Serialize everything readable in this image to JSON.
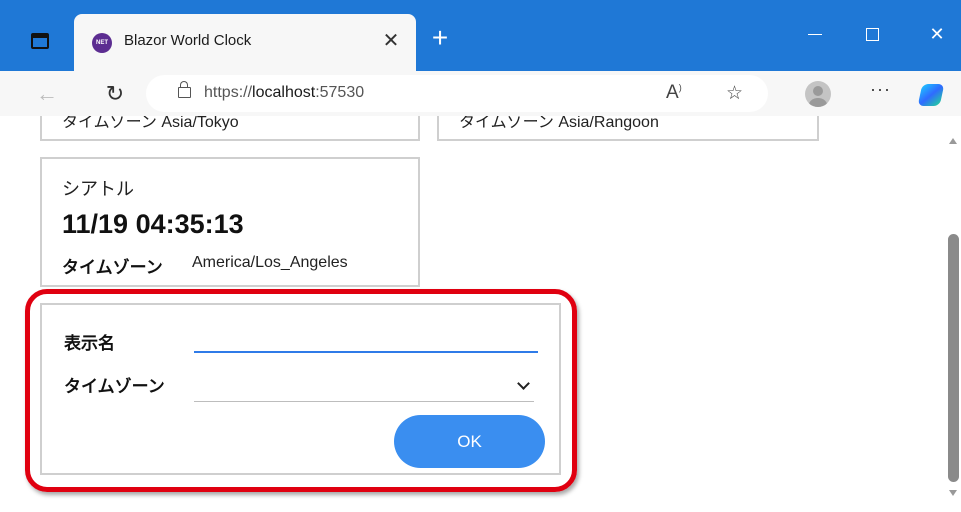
{
  "browser": {
    "tab_title": "Blazor World Clock",
    "favicon_text": "NET",
    "tab_close": "✕",
    "new_tab": "+",
    "url_prefix": "https://",
    "url_host": "localhost",
    "url_port": ":57530",
    "icons": {
      "back": "back-arrow-icon",
      "refresh": "refresh-icon",
      "lock": "site-info-icon",
      "read_aloud": "read-aloud-icon",
      "favorite": "favorite-star-icon",
      "profile": "profile-avatar-icon",
      "more": "more-icon",
      "copilot": "copilot-icon"
    },
    "window_controls": [
      "minimize",
      "maximize",
      "close"
    ]
  },
  "clocks_partial_row": [
    {
      "text": "タイムゾーン  Asia/Tokyo"
    },
    {
      "text": "タイムゾーン  Asia/Rangoon"
    }
  ],
  "clock_card": {
    "name": "シアトル",
    "time": "11/19 04:35:13",
    "tz_label": "タイムゾーン",
    "tz_value": "America/Los_Angeles"
  },
  "add_form": {
    "name_label": "表示名",
    "name_value": "",
    "timezone_label": "タイムゾーン",
    "timezone_value": "",
    "ok_label": "OK"
  },
  "colors": {
    "titlebar": "#1f78d6",
    "ok_button": "#3a8ef0",
    "highlight": "#e00010",
    "input_underline": "#2f7be8"
  }
}
